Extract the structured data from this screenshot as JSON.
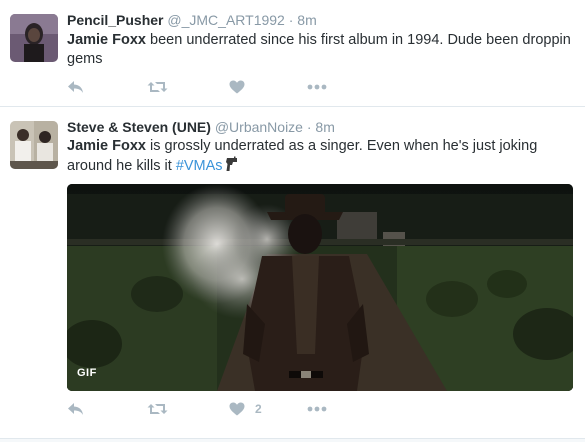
{
  "tweets": [
    {
      "fullname": "Pencil_Pusher",
      "handle": "@_JMC_ART1992",
      "separator": "·",
      "time": "8m",
      "text_highlight": "Jamie Foxx",
      "text_rest": " been underrated since his first album in 1994. Dude been droppin gems",
      "actions": {
        "reply_icon": "reply-icon",
        "retweet_icon": "retweet-icon",
        "like_icon": "heart-icon",
        "like_count": "",
        "more_icon": "more-icon"
      }
    },
    {
      "fullname": "Steve & Steven (UNE)",
      "handle": "@UrbanNoize",
      "separator": "·",
      "time": "8m",
      "text_highlight": "Jamie Foxx",
      "text_rest": " is grossly underrated as a singer. Even when he's just joking around he kills it ",
      "hashtag": "#VMAs",
      "emoji_icon": "gun-icon",
      "media": {
        "badge": "GIF",
        "icon": "gif-badge"
      },
      "actions": {
        "reply_icon": "reply-icon",
        "retweet_icon": "retweet-icon",
        "like_icon": "heart-icon",
        "like_count": "2",
        "more_icon": "more-icon"
      }
    }
  ],
  "colors": {
    "link": "#3b94d9",
    "action_gray": "#aab8c2",
    "meta_gray": "#8899a6",
    "text": "#292f33",
    "divider": "#e1e8ed"
  }
}
